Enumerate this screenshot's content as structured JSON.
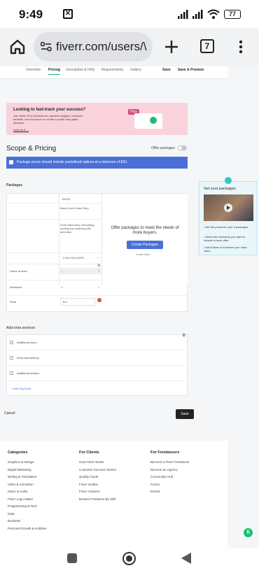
{
  "status": {
    "time": "9:49",
    "battery": "77"
  },
  "browser": {
    "url": "fiverr.com/users/\\",
    "tab_count": "7"
  },
  "subnav": {
    "tabs": [
      "Overview",
      "Pricing",
      "Description & FAQ",
      "Requirements",
      "Gallery"
    ],
    "active": "Pricing",
    "save": "Save",
    "save_preview": "Save & Preview"
  },
  "promo": {
    "title": "Looking to fast-track your success?",
    "body": "Join Seller Plus Kickstart for valuable insights, exclusive benefits, and resources to create a profile that grabs attention.",
    "link": "Let's do it →",
    "badge": "Plus"
  },
  "scope": {
    "title": "Scope & Pricing",
    "offer_packages_label": "Offer packages",
    "banner": "Package prices should include predefined options at a minimum of $20."
  },
  "packages": {
    "label": "Packages",
    "column": "BASIC",
    "name": "Basic Excel Data Entry",
    "description": "Excel data entry, formatting, sorting and cleaning with accuracy",
    "delivery": "1 DAY DELIVERY",
    "rows": [
      {
        "label": "Hours of work",
        "value": "-"
      },
      {
        "label": "Revisions",
        "value": "1"
      },
      {
        "label": "Price",
        "value": "$ 5"
      }
    ],
    "overlay_message": "Offer packages to meet the needs of more buyers.",
    "overlay_button": "Create Packages",
    "overlay_more": "Learn More"
  },
  "extras": {
    "label": "Add extra services",
    "items": [
      "Additional hours",
      "Extra fast delivery",
      "Additional revision"
    ],
    "add": "+ Add Gig Extra"
  },
  "actions": {
    "cancel": "Cancel",
    "save": "Save"
  },
  "tip": {
    "title": "Set your packages",
    "bullets": [
      "Set the prices for your 3 packages.",
      "Select the elements you want to include in each offer.",
      "Add Extras to increase your order value."
    ]
  },
  "footer": {
    "categories": {
      "title": "Categories",
      "items": [
        "Graphics & Design",
        "Digital Marketing",
        "Writing & Translation",
        "Video & Animation",
        "Music & Audio",
        "Fiverr Logo Maker",
        "Programming & Tech",
        "Data",
        "Business",
        "Personal Growth & Hobbies"
      ]
    },
    "clients": {
      "title": "For Clients",
      "items": [
        "How Fiverr Works",
        "Customer Success Stories",
        "Quality Guide",
        "Fiverr Guides",
        "Fiverr Answers",
        "Browse Freelance By Skill"
      ]
    },
    "freelancers": {
      "title": "For Freelancers",
      "items": [
        "Become a Fiverr Freelancer",
        "Become an Agency",
        "Community Hub",
        "Forum",
        "Events"
      ]
    }
  },
  "colors": {
    "accent_green": "#1dbf73",
    "banner_blue": "#4a6fd6",
    "promo_pink": "#fad2dc"
  }
}
